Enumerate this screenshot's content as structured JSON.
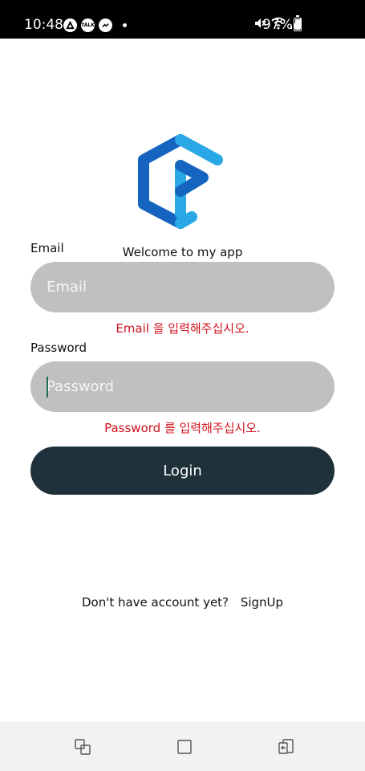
{
  "status_bar": {
    "time": "10:48",
    "left_icons": [
      "app-icon",
      "talk-icon",
      "messenger-icon"
    ],
    "talk_text": "TALK",
    "battery_text": "97%",
    "battery_level": 0.97
  },
  "logo": {
    "icon": "app-logo-icon",
    "colors": [
      "#1565c0",
      "#29a8e6"
    ]
  },
  "welcome_text": "Welcome to my app",
  "email": {
    "label": "Email",
    "placeholder": "Email",
    "value": "",
    "error": "Email 을 입력해주십시오."
  },
  "password": {
    "label": "Password",
    "placeholder": "Password",
    "value": "",
    "error": "Password 를 입력해주십시오."
  },
  "login_button": {
    "label": "Login"
  },
  "signup": {
    "prompt": "Don't have account yet?",
    "link": "SignUp"
  },
  "nav_bar": {
    "buttons": [
      "recent-apps-icon",
      "home-icon",
      "back-icon"
    ]
  },
  "colors": {
    "field_bg": "#c0c0c0",
    "button_bg": "#1f313a",
    "error": "#d0121b"
  }
}
